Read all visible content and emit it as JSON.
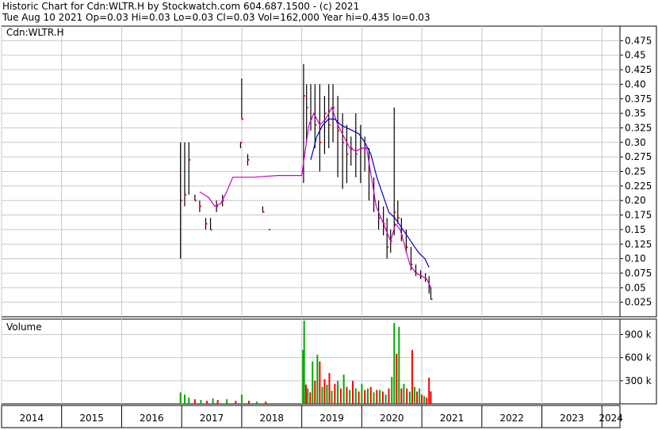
{
  "header": {
    "line1": "Historic Chart for Cdn:WLTR.H by Stockwatch.com 604.687.1500 - (c) 2021",
    "line2": "Tue Aug 10 2021  Op=0.03  Hi=0.03  Lo=0.03  Cl=0.03  Vol=162,000  Year hi=0.435  lo=0.03"
  },
  "chart_data": [
    {
      "type": "line",
      "title": "Cdn:WLTR.H",
      "ylim": [
        0,
        0.5
      ],
      "y_ticks": [
        "0.475",
        "0.45",
        "0.425",
        "0.40",
        "0.375",
        "0.35",
        "0.325",
        "0.30",
        "0.275",
        "0.25",
        "0.225",
        "0.20",
        "0.175",
        "0.15",
        "0.125",
        "0.10",
        "0.075",
        "0.05",
        "0.025"
      ],
      "x_ticks": [
        "2014",
        "2015",
        "2016",
        "2017",
        "2018",
        "2019",
        "2020",
        "2021",
        "2022",
        "2023",
        "2024"
      ],
      "grid": true,
      "colors": {
        "ma_short": "#cc00cc",
        "ma_long": "#0000cc",
        "bar": "#000000",
        "close": "#ff0000"
      },
      "series": [
        {
          "name": "",
          "style": "price-bars",
          "points": [
            {
              "x": 2016.98,
              "lo": 0.1,
              "hi": 0.3,
              "c": 0.2
            },
            {
              "x": 2017.05,
              "lo": 0.19,
              "hi": 0.3,
              "c": 0.21
            },
            {
              "x": 2017.12,
              "lo": 0.21,
              "hi": 0.3,
              "c": 0.27
            },
            {
              "x": 2017.22,
              "lo": 0.2,
              "hi": 0.21,
              "c": 0.2
            },
            {
              "x": 2017.3,
              "lo": 0.18,
              "hi": 0.2,
              "c": 0.19
            },
            {
              "x": 2017.4,
              "lo": 0.15,
              "hi": 0.17,
              "c": 0.16
            },
            {
              "x": 2017.48,
              "lo": 0.15,
              "hi": 0.17,
              "c": 0.15
            },
            {
              "x": 2017.58,
              "lo": 0.18,
              "hi": 0.2,
              "c": 0.19
            },
            {
              "x": 2017.68,
              "lo": 0.19,
              "hi": 0.21,
              "c": 0.2
            },
            {
              "x": 2018.0,
              "lo": 0.34,
              "hi": 0.41,
              "c": 0.34
            },
            {
              "x": 2017.98,
              "lo": 0.29,
              "hi": 0.3,
              "c": 0.3
            },
            {
              "x": 2018.1,
              "lo": 0.26,
              "hi": 0.28,
              "c": 0.27
            },
            {
              "x": 2018.35,
              "lo": 0.18,
              "hi": 0.19,
              "c": 0.18
            },
            {
              "x": 2018.45,
              "lo": 0.15,
              "hi": 0.15,
              "c": 0.15
            },
            {
              "x": 2019.03,
              "lo": 0.23,
              "hi": 0.435,
              "c": 0.38
            },
            {
              "x": 2019.08,
              "lo": 0.3,
              "hi": 0.4,
              "c": 0.36
            },
            {
              "x": 2019.15,
              "lo": 0.32,
              "hi": 0.4,
              "c": 0.34
            },
            {
              "x": 2019.22,
              "lo": 0.29,
              "hi": 0.4,
              "c": 0.33
            },
            {
              "x": 2019.3,
              "lo": 0.25,
              "hi": 0.4,
              "c": 0.3
            },
            {
              "x": 2019.38,
              "lo": 0.28,
              "hi": 0.38,
              "c": 0.35
            },
            {
              "x": 2019.45,
              "lo": 0.29,
              "hi": 0.4,
              "c": 0.33
            },
            {
              "x": 2019.52,
              "lo": 0.3,
              "hi": 0.4,
              "c": 0.36
            },
            {
              "x": 2019.6,
              "lo": 0.24,
              "hi": 0.38,
              "c": 0.32
            },
            {
              "x": 2019.68,
              "lo": 0.22,
              "hi": 0.35,
              "c": 0.3
            },
            {
              "x": 2019.75,
              "lo": 0.23,
              "hi": 0.33,
              "c": 0.28
            },
            {
              "x": 2019.82,
              "lo": 0.26,
              "hi": 0.31,
              "c": 0.29
            },
            {
              "x": 2019.9,
              "lo": 0.24,
              "hi": 0.35,
              "c": 0.28
            },
            {
              "x": 2019.98,
              "lo": 0.23,
              "hi": 0.33,
              "c": 0.29
            },
            {
              "x": 2020.05,
              "lo": 0.25,
              "hi": 0.31,
              "c": 0.29
            },
            {
              "x": 2020.12,
              "lo": 0.2,
              "hi": 0.29,
              "c": 0.25
            },
            {
              "x": 2020.2,
              "lo": 0.18,
              "hi": 0.24,
              "c": 0.2
            },
            {
              "x": 2020.28,
              "lo": 0.15,
              "hi": 0.2,
              "c": 0.17
            },
            {
              "x": 2020.36,
              "lo": 0.14,
              "hi": 0.19,
              "c": 0.16
            },
            {
              "x": 2020.42,
              "lo": 0.1,
              "hi": 0.17,
              "c": 0.12
            },
            {
              "x": 2020.48,
              "lo": 0.11,
              "hi": 0.15,
              "c": 0.13
            },
            {
              "x": 2020.54,
              "lo": 0.14,
              "hi": 0.36,
              "c": 0.18
            },
            {
              "x": 2020.6,
              "lo": 0.16,
              "hi": 0.2,
              "c": 0.17
            },
            {
              "x": 2020.66,
              "lo": 0.13,
              "hi": 0.17,
              "c": 0.14
            },
            {
              "x": 2020.74,
              "lo": 0.11,
              "hi": 0.15,
              "c": 0.12
            },
            {
              "x": 2020.82,
              "lo": 0.08,
              "hi": 0.12,
              "c": 0.09
            },
            {
              "x": 2020.9,
              "lo": 0.07,
              "hi": 0.09,
              "c": 0.075
            },
            {
              "x": 2020.98,
              "lo": 0.065,
              "hi": 0.08,
              "c": 0.07
            },
            {
              "x": 2021.06,
              "lo": 0.06,
              "hi": 0.075,
              "c": 0.065
            },
            {
              "x": 2021.12,
              "lo": 0.04,
              "hi": 0.07,
              "c": 0.05
            },
            {
              "x": 2021.15,
              "lo": 0.03,
              "hi": 0.05,
              "c": 0.03
            }
          ]
        },
        {
          "name": "",
          "style": "ma_short",
          "points": [
            [
              2017.3,
              0.215
            ],
            [
              2017.45,
              0.205
            ],
            [
              2017.55,
              0.19
            ],
            [
              2017.65,
              0.195
            ],
            [
              2017.75,
              0.215
            ],
            [
              2017.85,
              0.24
            ],
            [
              2018.2,
              0.24
            ],
            [
              2018.6,
              0.243
            ],
            [
              2019.0,
              0.243
            ],
            [
              2019.05,
              0.28
            ],
            [
              2019.12,
              0.33
            ],
            [
              2019.2,
              0.35
            ],
            [
              2019.3,
              0.33
            ],
            [
              2019.4,
              0.34
            ],
            [
              2019.5,
              0.36
            ],
            [
              2019.6,
              0.33
            ],
            [
              2019.7,
              0.31
            ],
            [
              2019.8,
              0.29
            ],
            [
              2019.9,
              0.285
            ],
            [
              2020.0,
              0.29
            ],
            [
              2020.08,
              0.29
            ],
            [
              2020.16,
              0.24
            ],
            [
              2020.24,
              0.19
            ],
            [
              2020.32,
              0.17
            ],
            [
              2020.4,
              0.15
            ],
            [
              2020.48,
              0.13
            ],
            [
              2020.56,
              0.16
            ],
            [
              2020.64,
              0.15
            ],
            [
              2020.72,
              0.12
            ],
            [
              2020.8,
              0.09
            ],
            [
              2020.9,
              0.075
            ],
            [
              2021.0,
              0.07
            ],
            [
              2021.08,
              0.065
            ],
            [
              2021.15,
              0.05
            ]
          ]
        },
        {
          "name": "",
          "style": "ma_long",
          "points": [
            [
              2019.15,
              0.27
            ],
            [
              2019.25,
              0.31
            ],
            [
              2019.35,
              0.33
            ],
            [
              2019.45,
              0.34
            ],
            [
              2019.55,
              0.34
            ],
            [
              2019.65,
              0.33
            ],
            [
              2019.75,
              0.325
            ],
            [
              2019.85,
              0.32
            ],
            [
              2019.95,
              0.315
            ],
            [
              2020.05,
              0.3
            ],
            [
              2020.15,
              0.28
            ],
            [
              2020.25,
              0.24
            ],
            [
              2020.35,
              0.21
            ],
            [
              2020.45,
              0.18
            ],
            [
              2020.55,
              0.17
            ],
            [
              2020.65,
              0.155
            ],
            [
              2020.75,
              0.14
            ],
            [
              2020.85,
              0.125
            ],
            [
              2020.95,
              0.11
            ],
            [
              2021.05,
              0.1
            ],
            [
              2021.12,
              0.085
            ]
          ]
        }
      ]
    },
    {
      "type": "bar",
      "title": "Volume",
      "ylim": [
        0,
        1100000
      ],
      "y_ticks": [
        "900 k",
        "600 k",
        "300 k"
      ],
      "colors": {
        "up": "#00aa00",
        "down": "#ff0000"
      },
      "series": [
        {
          "name": "",
          "points": [
            [
              2016.98,
              150000,
              "up"
            ],
            [
              2017.05,
              120000,
              "up"
            ],
            [
              2017.12,
              80000,
              "up"
            ],
            [
              2017.22,
              60000,
              "down"
            ],
            [
              2017.32,
              50000,
              "up"
            ],
            [
              2017.42,
              40000,
              "down"
            ],
            [
              2017.52,
              70000,
              "up"
            ],
            [
              2017.6,
              50000,
              "down"
            ],
            [
              2017.75,
              60000,
              "up"
            ],
            [
              2017.9,
              40000,
              "down"
            ],
            [
              2018.0,
              120000,
              "up"
            ],
            [
              2018.12,
              40000,
              "down"
            ],
            [
              2018.25,
              30000,
              "up"
            ],
            [
              2018.4,
              30000,
              "down"
            ],
            [
              2019.02,
              700000,
              "up"
            ],
            [
              2019.04,
              1080000,
              "up"
            ],
            [
              2019.07,
              250000,
              "down"
            ],
            [
              2019.1,
              200000,
              "up"
            ],
            [
              2019.14,
              150000,
              "down"
            ],
            [
              2019.18,
              550000,
              "up"
            ],
            [
              2019.22,
              300000,
              "down"
            ],
            [
              2019.26,
              640000,
              "up"
            ],
            [
              2019.3,
              550000,
              "down"
            ],
            [
              2019.34,
              220000,
              "up"
            ],
            [
              2019.38,
              320000,
              "down"
            ],
            [
              2019.42,
              250000,
              "up"
            ],
            [
              2019.46,
              400000,
              "down"
            ],
            [
              2019.5,
              170000,
              "up"
            ],
            [
              2019.55,
              260000,
              "down"
            ],
            [
              2019.6,
              300000,
              "up"
            ],
            [
              2019.65,
              200000,
              "down"
            ],
            [
              2019.7,
              380000,
              "up"
            ],
            [
              2019.75,
              220000,
              "down"
            ],
            [
              2019.8,
              180000,
              "up"
            ],
            [
              2019.85,
              300000,
              "down"
            ],
            [
              2019.9,
              200000,
              "up"
            ],
            [
              2019.95,
              160000,
              "down"
            ],
            [
              2020.0,
              260000,
              "up"
            ],
            [
              2020.05,
              180000,
              "down"
            ],
            [
              2020.1,
              200000,
              "up"
            ],
            [
              2020.15,
              220000,
              "down"
            ],
            [
              2020.2,
              150000,
              "up"
            ],
            [
              2020.25,
              180000,
              "down"
            ],
            [
              2020.3,
              180000,
              "up"
            ],
            [
              2020.35,
              160000,
              "down"
            ],
            [
              2020.4,
              120000,
              "up"
            ],
            [
              2020.45,
              200000,
              "down"
            ],
            [
              2020.5,
              350000,
              "up"
            ],
            [
              2020.54,
              1050000,
              "up"
            ],
            [
              2020.58,
              650000,
              "down"
            ],
            [
              2020.62,
              1000000,
              "up"
            ],
            [
              2020.66,
              200000,
              "down"
            ],
            [
              2020.7,
              260000,
              "up"
            ],
            [
              2020.75,
              200000,
              "down"
            ],
            [
              2020.8,
              160000,
              "up"
            ],
            [
              2020.84,
              700000,
              "down"
            ],
            [
              2020.88,
              220000,
              "up"
            ],
            [
              2020.92,
              160000,
              "down"
            ],
            [
              2020.96,
              200000,
              "up"
            ],
            [
              2021.0,
              120000,
              "down"
            ],
            [
              2021.04,
              100000,
              "up"
            ],
            [
              2021.08,
              80000,
              "down"
            ],
            [
              2021.12,
              340000,
              "down"
            ],
            [
              2021.15,
              162000,
              "down"
            ]
          ]
        }
      ]
    }
  ]
}
